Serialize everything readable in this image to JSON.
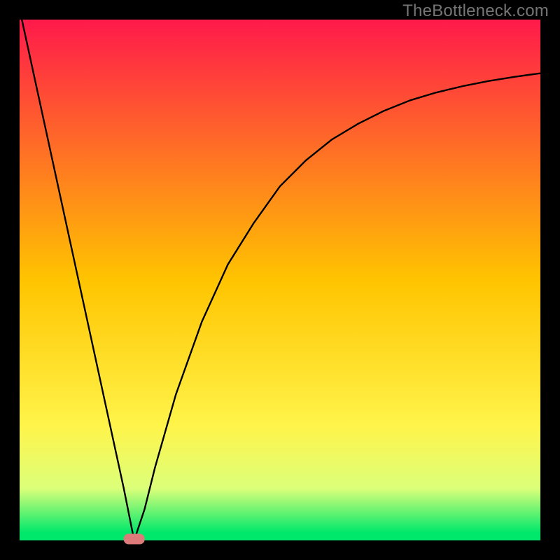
{
  "watermark": "TheBottleneck.com",
  "chart_data": {
    "type": "line",
    "title": "",
    "xlabel": "",
    "ylabel": "",
    "xlim": [
      0,
      100
    ],
    "ylim": [
      0,
      100
    ],
    "grid": false,
    "legend": false,
    "curve": {
      "description": "V-shaped bottleneck curve with minimum near x≈22",
      "x": [
        0,
        5,
        10,
        15,
        20,
        22,
        24,
        26,
        30,
        35,
        40,
        45,
        50,
        55,
        60,
        65,
        70,
        75,
        80,
        85,
        90,
        95,
        100
      ],
      "y": [
        102,
        79,
        56,
        33,
        10,
        0,
        6,
        14,
        28,
        42,
        53,
        61,
        68,
        73,
        77,
        80,
        82.5,
        84.5,
        86,
        87.2,
        88.2,
        89,
        89.7
      ]
    },
    "marker": {
      "description": "pill-shaped marker at the curve minimum",
      "x": 22,
      "y": 0,
      "color": "#dd7b7a"
    },
    "background_gradient": {
      "stops": [
        {
          "offset": 0.0,
          "color": "#ff1a4b"
        },
        {
          "offset": 0.5,
          "color": "#ffc400"
        },
        {
          "offset": 0.78,
          "color": "#fff44a"
        },
        {
          "offset": 0.9,
          "color": "#dcff7a"
        },
        {
          "offset": 0.985,
          "color": "#00e86b"
        }
      ]
    },
    "frame_color": "#000000",
    "frame_thickness_px": 28
  }
}
